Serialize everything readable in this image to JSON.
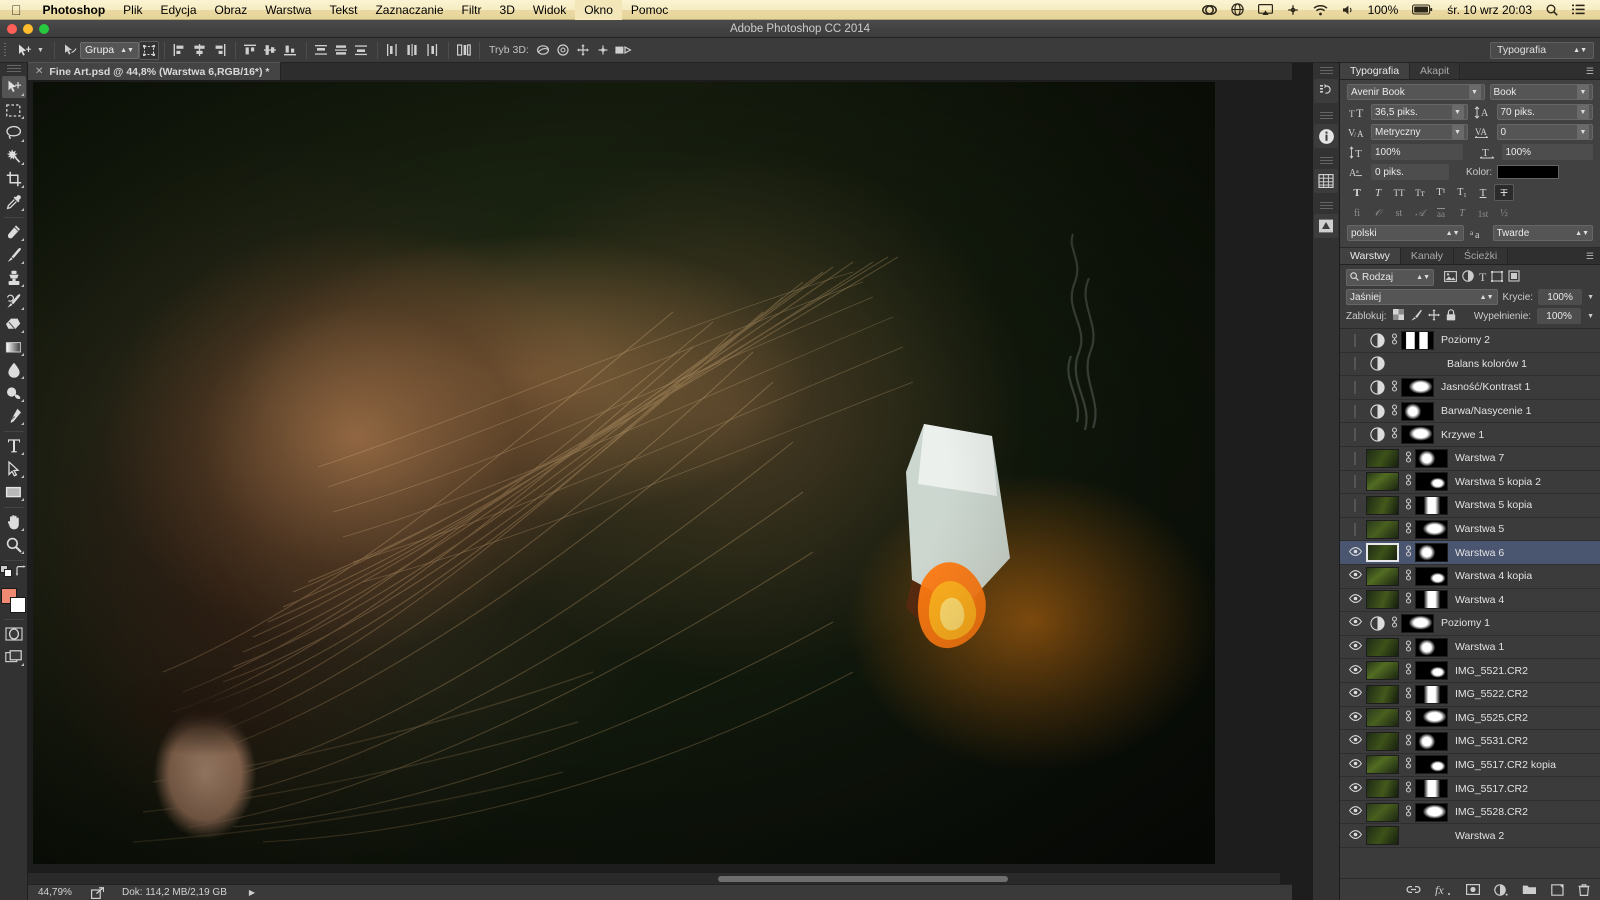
{
  "macbar": {
    "apple": "apple-logo",
    "menus": [
      "Photoshop",
      "Plik",
      "Edycja",
      "Obraz",
      "Warstwa",
      "Tekst",
      "Zaznaczanie",
      "Filtr",
      "3D",
      "Widok",
      "Okno",
      "Pomoc"
    ],
    "active_menu": "Okno",
    "status": {
      "creative_cloud": "cc-icon",
      "globe": "globe-icon",
      "airplay": "airplay-icon",
      "dropbox": "dropbox-icon",
      "wifi": "wifi-icon",
      "volume": "volume-icon",
      "battery_percent": "100%",
      "battery": "battery-icon",
      "datetime": "śr. 10 wrz  20:03",
      "search": "search-icon",
      "notifications": "notification-center-icon"
    }
  },
  "titlebar": {
    "title": "Adobe Photoshop CC 2014"
  },
  "options_bar": {
    "tool_icon": "move-tool-icon",
    "tool_preset_caret": "chevron-down-icon",
    "auto_select_icon": "auto-select-icon",
    "group_select": "Grupa",
    "show_transform_icon": "transform-controls-icon",
    "align": [
      "align-left-edges-icon",
      "align-horizontal-centers-icon",
      "align-right-edges-icon",
      "align-top-edges-icon",
      "align-vertical-centers-icon",
      "align-bottom-edges-icon"
    ],
    "distribute": [
      "distribute-top-edges-icon",
      "distribute-vertical-centers-icon",
      "distribute-bottom-edges-icon",
      "distribute-left-edges-icon",
      "distribute-horizontal-centers-icon",
      "distribute-right-edges-icon"
    ],
    "auto_align_icon": "auto-align-layers-icon",
    "mode3d_label": "Tryb 3D:",
    "mode3d": [
      "3d-orbit-icon",
      "3d-roll-icon",
      "3d-pan-icon",
      "3d-slide-icon",
      "3d-scale-icon"
    ],
    "workspace": "Typografia",
    "workspace_caret": "chevron-down-icon"
  },
  "tools": {
    "items": [
      {
        "name": "move-tool",
        "label": "Przesunięcie",
        "active": true
      },
      {
        "name": "rectangular-marquee-tool",
        "label": "Zaznaczenie prostokątne",
        "active": false
      },
      {
        "name": "lasso-tool",
        "label": "Lasso",
        "active": false
      },
      {
        "name": "magic-wand-tool",
        "label": "Różdżka",
        "active": false
      },
      {
        "name": "crop-tool",
        "label": "Kadrowanie",
        "active": false
      },
      {
        "name": "eyedropper-tool",
        "label": "Kroplomierz",
        "active": false
      },
      {
        "name": "spot-healing-brush-tool",
        "label": "Punktowy pędzel korygujący",
        "active": false
      },
      {
        "name": "brush-tool",
        "label": "Pędzel",
        "active": false
      },
      {
        "name": "clone-stamp-tool",
        "label": "Stempel",
        "active": false
      },
      {
        "name": "history-brush-tool",
        "label": "Pędzel historii",
        "active": false
      },
      {
        "name": "eraser-tool",
        "label": "Gumka",
        "active": false
      },
      {
        "name": "gradient-tool",
        "label": "Gradient",
        "active": false
      },
      {
        "name": "blur-tool",
        "label": "Rozmycie",
        "active": false
      },
      {
        "name": "dodge-tool",
        "label": "Rozjaśnianie",
        "active": false
      },
      {
        "name": "pen-tool",
        "label": "Pióro",
        "active": false
      },
      {
        "name": "type-tool",
        "label": "Tekst",
        "active": false
      },
      {
        "name": "path-selection-tool",
        "label": "Zaznaczanie ścieżki",
        "active": false
      },
      {
        "name": "rectangle-tool",
        "label": "Prostokąt",
        "active": false
      },
      {
        "name": "hand-tool",
        "label": "Rączka",
        "active": false
      },
      {
        "name": "zoom-tool",
        "label": "Lupka",
        "active": false
      }
    ],
    "default_colors_icon": "default-colors-icon",
    "swap_colors_icon": "swap-colors-icon",
    "foreground_color": "#ef8a72",
    "background_color": "#ffffff",
    "quick_mask_icon": "quick-mask-icon",
    "screen_mode_icon": "screen-mode-icon"
  },
  "document": {
    "tab_close_icon": "close-icon",
    "tab_title": "Fine Art.psd @ 44,8% (Warstwa 6,RGB/16*) *"
  },
  "status_bar": {
    "zoom": "44,79%",
    "share_icon": "share-icon",
    "doc_info": "Dok: 114,2 MB/2,19 GB",
    "expand_icon": "triangle-right-icon"
  },
  "dock_rail": {
    "items": [
      {
        "name": "history-panel-icon",
        "label": "Historia"
      },
      {
        "name": "info-panel-icon",
        "label": "Info"
      },
      {
        "name": "properties-panel-icon",
        "label": "Właściwości"
      },
      {
        "name": "adjustments-panel-icon",
        "label": "Dopasowania"
      }
    ]
  },
  "typography_panel": {
    "tabs": [
      {
        "label": "Typografia",
        "active": true
      },
      {
        "label": "Akapit",
        "active": false
      }
    ],
    "menu_icon": "panel-menu-icon",
    "font_family": "Avenir Book",
    "font_style": "Book",
    "size_icon": "font-size-icon",
    "font_size": "36,5 piks.",
    "leading_icon": "leading-icon",
    "leading": "70 piks.",
    "kerning_icon": "kerning-icon",
    "kerning": "Metryczny",
    "tracking_icon": "tracking-icon",
    "tracking": "0",
    "vscale_icon": "vertical-scale-icon",
    "vertical_scale": "100%",
    "hscale_icon": "horizontal-scale-icon",
    "horizontal_scale": "100%",
    "baseline_icon": "baseline-shift-icon",
    "baseline_shift": "0 piks.",
    "color_label": "Kolor:",
    "color_value": "#000000",
    "style_buttons": [
      "T",
      "T",
      "TT",
      "Tт",
      "T¹",
      "T₁",
      "T",
      "T"
    ],
    "style_buttons_names": [
      "faux-bold-icon",
      "faux-italic-icon",
      "all-caps-icon",
      "small-caps-icon",
      "superscript-icon",
      "subscript-icon",
      "underline-icon",
      "strikethrough-icon"
    ],
    "style_active_index": 7,
    "opentype_buttons": [
      "fi",
      "𝒪",
      "st",
      "𝒜",
      "aa",
      "T",
      "1st",
      "½"
    ],
    "opentype_names": [
      "standard-ligatures-icon",
      "contextual-alternates-icon",
      "discretionary-ligatures-icon",
      "swash-icon",
      "oldstyle-icon",
      "titling-alternates-icon",
      "ordinals-icon",
      "fractions-icon"
    ],
    "language": "polski",
    "antialias_icon": "anti-aliasing-icon",
    "antialias": "Twarde"
  },
  "layers_panel": {
    "tabs": [
      {
        "label": "Warstwy",
        "active": true
      },
      {
        "label": "Kanały",
        "active": false
      },
      {
        "label": "Ścieżki",
        "active": false
      }
    ],
    "menu_icon": "panel-menu-icon",
    "filter_icon": "search-icon",
    "filter_kind": "Rodzaj",
    "filter_buttons": [
      "filter-pixel-layers-icon",
      "filter-adjustment-layers-icon",
      "filter-type-layers-icon",
      "filter-shape-layers-icon",
      "filter-smart-objects-icon"
    ],
    "blend_mode": "Jaśniej",
    "opacity_label": "Krycie:",
    "opacity_value": "100%",
    "lock_label": "Zablokuj:",
    "lock_icons": [
      "lock-transparent-pixels-icon",
      "lock-image-pixels-icon",
      "lock-position-icon",
      "lock-all-icon"
    ],
    "fill_label": "Wypełnienie:",
    "fill_value": "100%",
    "layers": [
      {
        "name": "Poziomy 2",
        "visible": false,
        "type": "adjustment",
        "has_mask": true,
        "partial": true
      },
      {
        "name": "Balans kolorów 1",
        "visible": false,
        "type": "adjustment",
        "has_mask": false
      },
      {
        "name": "Jasność/Kontrast 1",
        "visible": false,
        "type": "adjustment",
        "has_mask": true
      },
      {
        "name": "Barwa/Nasycenie 1",
        "visible": false,
        "type": "adjustment",
        "has_mask": true
      },
      {
        "name": "Krzywe 1",
        "visible": false,
        "type": "adjustment",
        "has_mask": true
      },
      {
        "name": "Warstwa 7",
        "visible": false,
        "type": "pixel",
        "has_mask": true
      },
      {
        "name": "Warstwa 5 kopia 2",
        "visible": false,
        "type": "pixel",
        "has_mask": true
      },
      {
        "name": "Warstwa 5 kopia",
        "visible": false,
        "type": "pixel",
        "has_mask": true
      },
      {
        "name": "Warstwa 5",
        "visible": false,
        "type": "pixel",
        "has_mask": true
      },
      {
        "name": "Warstwa 6",
        "visible": true,
        "type": "pixel",
        "has_mask": true,
        "selected": true
      },
      {
        "name": "Warstwa 4 kopia",
        "visible": true,
        "type": "pixel",
        "has_mask": true
      },
      {
        "name": "Warstwa 4",
        "visible": true,
        "type": "pixel",
        "has_mask": true
      },
      {
        "name": "Poziomy 1",
        "visible": true,
        "type": "adjustment",
        "has_mask": true
      },
      {
        "name": "Warstwa 1",
        "visible": true,
        "type": "pixel",
        "has_mask": true
      },
      {
        "name": "IMG_5521.CR2",
        "visible": true,
        "type": "pixel",
        "has_mask": true
      },
      {
        "name": "IMG_5522.CR2",
        "visible": true,
        "type": "pixel",
        "has_mask": true
      },
      {
        "name": "IMG_5525.CR2",
        "visible": true,
        "type": "pixel",
        "has_mask": true
      },
      {
        "name": "IMG_5531.CR2",
        "visible": true,
        "type": "pixel",
        "has_mask": true
      },
      {
        "name": "IMG_5517.CR2 kopia",
        "visible": true,
        "type": "pixel",
        "has_mask": true
      },
      {
        "name": "IMG_5517.CR2",
        "visible": true,
        "type": "pixel",
        "has_mask": true
      },
      {
        "name": "IMG_5528.CR2",
        "visible": true,
        "type": "pixel",
        "has_mask": true
      },
      {
        "name": "Warstwa 2",
        "visible": true,
        "type": "pixel",
        "has_mask": false
      }
    ],
    "footer_icons": [
      "link-layers-icon",
      "layer-style-icon",
      "add-layer-mask-icon",
      "new-adjustment-layer-icon",
      "new-group-icon",
      "new-layer-icon",
      "delete-layer-icon"
    ]
  }
}
